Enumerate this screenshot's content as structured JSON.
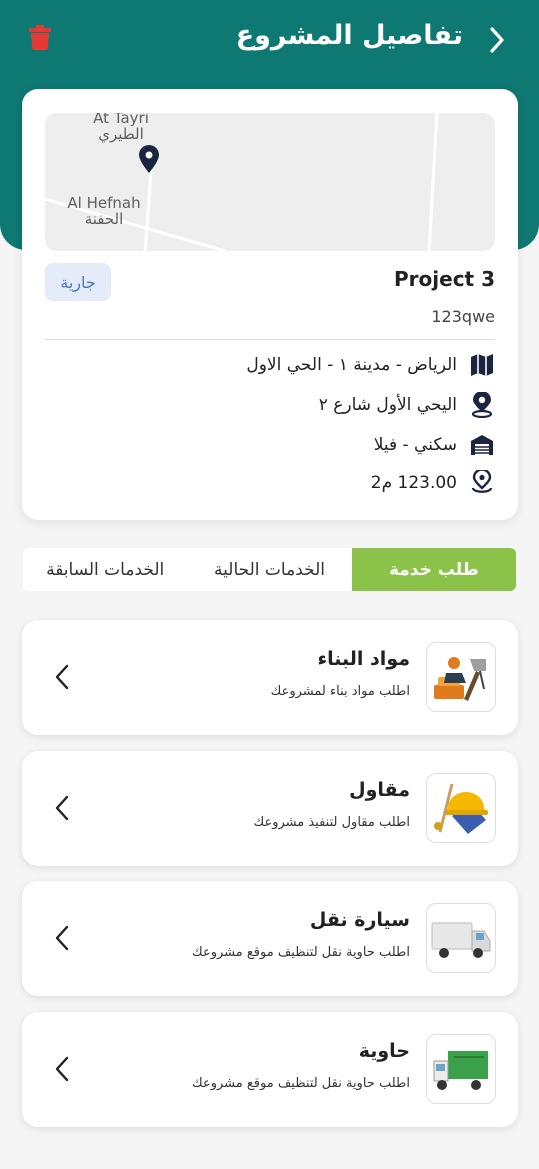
{
  "header": {
    "title": "تفاصيل المشروع",
    "background": "#0e7872",
    "back_icon": "chevron-right-icon",
    "delete_icon": "trash-icon",
    "delete_color": "#e53935"
  },
  "project": {
    "map": {
      "labels": [
        {
          "latin": "At Tayri",
          "arabic": "الطيري"
        },
        {
          "latin": "Al Hefnah",
          "arabic": "الحفنة"
        }
      ],
      "pin_icon": "map-pin-icon"
    },
    "status": "جارية",
    "name": "Project 3",
    "code": "123qwe",
    "details": [
      {
        "icon": "map-icon",
        "text": "الرياض - مدينة ١ - الحي الاول"
      },
      {
        "icon": "location-pin-icon",
        "text": "اليحي الأول شارع ٢"
      },
      {
        "icon": "warehouse-icon",
        "text": "سكني - فيلا"
      },
      {
        "icon": "area-pin-icon",
        "text": "123.00 م2"
      }
    ]
  },
  "tabs": [
    {
      "label": "طلب خدمة",
      "active": true
    },
    {
      "label": "الخدمات الحالية",
      "active": false
    },
    {
      "label": "الخدمات السابقة",
      "active": false
    }
  ],
  "services": [
    {
      "title": "مواد البناء",
      "subtitle": "اطلب مواد بناء لمشروعك",
      "icon": "construction-materials-icon"
    },
    {
      "title": "مقاول",
      "subtitle": "اطلب مقاول لتنفيذ مشروعك",
      "icon": "contractor-helmet-icon"
    },
    {
      "title": "سيارة نقل",
      "subtitle": "اطلب حاوية نقل لتنظيف موقع مشروعك",
      "icon": "transport-truck-icon"
    },
    {
      "title": "حاوية",
      "subtitle": "اطلب حاوية نقل لتنظيف موقع مشروعك",
      "icon": "garbage-truck-icon"
    }
  ],
  "colors": {
    "accent_green": "#8bc34a",
    "status_badge_bg": "#e3ecf8",
    "status_badge_text": "#4a76c1"
  }
}
